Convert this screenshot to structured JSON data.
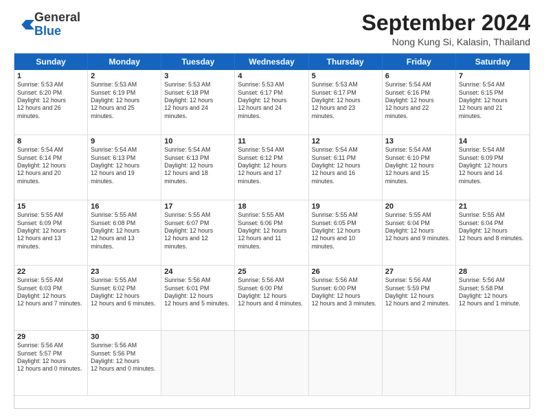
{
  "header": {
    "logo_general": "General",
    "logo_blue": "Blue",
    "month_title": "September 2024",
    "location": "Nong Kung Si, Kalasin, Thailand"
  },
  "weekdays": [
    "Sunday",
    "Monday",
    "Tuesday",
    "Wednesday",
    "Thursday",
    "Friday",
    "Saturday"
  ],
  "days": [
    {
      "num": "1",
      "sunrise": "5:53 AM",
      "sunset": "6:20 PM",
      "daylight": "12 hours and 26 minutes.",
      "col": 0
    },
    {
      "num": "2",
      "sunrise": "5:53 AM",
      "sunset": "6:19 PM",
      "daylight": "12 hours and 25 minutes.",
      "col": 1
    },
    {
      "num": "3",
      "sunrise": "5:53 AM",
      "sunset": "6:18 PM",
      "daylight": "12 hours and 24 minutes.",
      "col": 2
    },
    {
      "num": "4",
      "sunrise": "5:53 AM",
      "sunset": "6:17 PM",
      "daylight": "12 hours and 24 minutes.",
      "col": 3
    },
    {
      "num": "5",
      "sunrise": "5:53 AM",
      "sunset": "6:17 PM",
      "daylight": "12 hours and 23 minutes.",
      "col": 4
    },
    {
      "num": "6",
      "sunrise": "5:54 AM",
      "sunset": "6:16 PM",
      "daylight": "12 hours and 22 minutes.",
      "col": 5
    },
    {
      "num": "7",
      "sunrise": "5:54 AM",
      "sunset": "6:15 PM",
      "daylight": "12 hours and 21 minutes.",
      "col": 6
    },
    {
      "num": "8",
      "sunrise": "5:54 AM",
      "sunset": "6:14 PM",
      "daylight": "12 hours and 20 minutes.",
      "col": 0
    },
    {
      "num": "9",
      "sunrise": "5:54 AM",
      "sunset": "6:13 PM",
      "daylight": "12 hours and 19 minutes.",
      "col": 1
    },
    {
      "num": "10",
      "sunrise": "5:54 AM",
      "sunset": "6:13 PM",
      "daylight": "12 hours and 18 minutes.",
      "col": 2
    },
    {
      "num": "11",
      "sunrise": "5:54 AM",
      "sunset": "6:12 PM",
      "daylight": "12 hours and 17 minutes.",
      "col": 3
    },
    {
      "num": "12",
      "sunrise": "5:54 AM",
      "sunset": "6:11 PM",
      "daylight": "12 hours and 16 minutes.",
      "col": 4
    },
    {
      "num": "13",
      "sunrise": "5:54 AM",
      "sunset": "6:10 PM",
      "daylight": "12 hours and 15 minutes.",
      "col": 5
    },
    {
      "num": "14",
      "sunrise": "5:54 AM",
      "sunset": "6:09 PM",
      "daylight": "12 hours and 14 minutes.",
      "col": 6
    },
    {
      "num": "15",
      "sunrise": "5:55 AM",
      "sunset": "6:09 PM",
      "daylight": "12 hours and 13 minutes.",
      "col": 0
    },
    {
      "num": "16",
      "sunrise": "5:55 AM",
      "sunset": "6:08 PM",
      "daylight": "12 hours and 13 minutes.",
      "col": 1
    },
    {
      "num": "17",
      "sunrise": "5:55 AM",
      "sunset": "6:07 PM",
      "daylight": "12 hours and 12 minutes.",
      "col": 2
    },
    {
      "num": "18",
      "sunrise": "5:55 AM",
      "sunset": "6:06 PM",
      "daylight": "12 hours and 11 minutes.",
      "col": 3
    },
    {
      "num": "19",
      "sunrise": "5:55 AM",
      "sunset": "6:05 PM",
      "daylight": "12 hours and 10 minutes.",
      "col": 4
    },
    {
      "num": "20",
      "sunrise": "5:55 AM",
      "sunset": "6:04 PM",
      "daylight": "12 hours and 9 minutes.",
      "col": 5
    },
    {
      "num": "21",
      "sunrise": "5:55 AM",
      "sunset": "6:04 PM",
      "daylight": "12 hours and 8 minutes.",
      "col": 6
    },
    {
      "num": "22",
      "sunrise": "5:55 AM",
      "sunset": "6:03 PM",
      "daylight": "12 hours and 7 minutes.",
      "col": 0
    },
    {
      "num": "23",
      "sunrise": "5:55 AM",
      "sunset": "6:02 PM",
      "daylight": "12 hours and 6 minutes.",
      "col": 1
    },
    {
      "num": "24",
      "sunrise": "5:56 AM",
      "sunset": "6:01 PM",
      "daylight": "12 hours and 5 minutes.",
      "col": 2
    },
    {
      "num": "25",
      "sunrise": "5:56 AM",
      "sunset": "6:00 PM",
      "daylight": "12 hours and 4 minutes.",
      "col": 3
    },
    {
      "num": "26",
      "sunrise": "5:56 AM",
      "sunset": "6:00 PM",
      "daylight": "12 hours and 3 minutes.",
      "col": 4
    },
    {
      "num": "27",
      "sunrise": "5:56 AM",
      "sunset": "5:59 PM",
      "daylight": "12 hours and 2 minutes.",
      "col": 5
    },
    {
      "num": "28",
      "sunrise": "5:56 AM",
      "sunset": "5:58 PM",
      "daylight": "12 hours and 1 minute.",
      "col": 6
    },
    {
      "num": "29",
      "sunrise": "5:56 AM",
      "sunset": "5:57 PM",
      "daylight": "12 hours and 0 minutes.",
      "col": 0
    },
    {
      "num": "30",
      "sunrise": "5:56 AM",
      "sunset": "5:56 PM",
      "daylight": "12 hours and 0 minutes.",
      "col": 1
    }
  ]
}
